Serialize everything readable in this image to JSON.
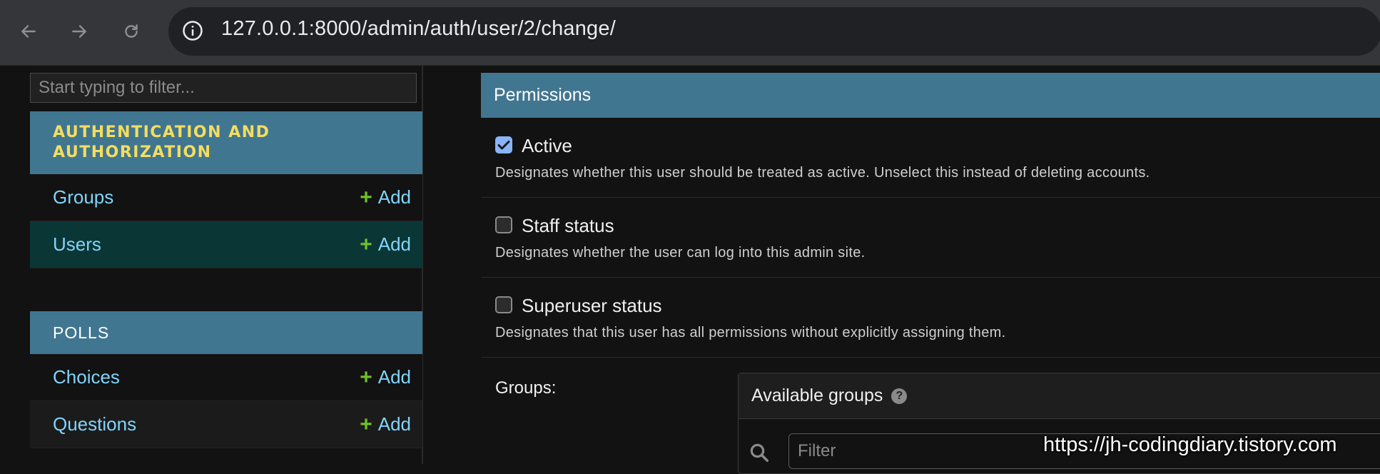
{
  "browser": {
    "url": "127.0.0.1:8000/admin/auth/user/2/change/",
    "icons": [
      "back-arrow-icon",
      "forward-arrow-icon",
      "reload-icon",
      "info-icon"
    ]
  },
  "sidebar": {
    "filter_placeholder": "Start typing to filter...",
    "apps": [
      {
        "name": "AUTHENTICATION AND AUTHORIZATION",
        "models": [
          {
            "name": "Groups",
            "add": "Add"
          },
          {
            "name": "Users",
            "add": "Add",
            "active": true
          }
        ]
      },
      {
        "name": "POLLS",
        "models": [
          {
            "name": "Choices",
            "add": "Add"
          },
          {
            "name": "Questions",
            "add": "Add"
          }
        ]
      }
    ]
  },
  "main": {
    "fieldset_title": "Permissions",
    "fields": [
      {
        "label": "Active",
        "checked": true,
        "help": "Designates whether this user should be treated as active. Unselect this instead of deleting accounts."
      },
      {
        "label": "Staff status",
        "checked": false,
        "help": "Designates whether the user can log into this admin site."
      },
      {
        "label": "Superuser status",
        "checked": false,
        "help": "Designates that this user has all permissions without explicitly assigning them."
      }
    ],
    "groups": {
      "label": "Groups:",
      "selector_title": "Available groups",
      "filter_placeholder": "Filter"
    }
  },
  "watermark": "https://jh-codingdiary.tistory.com",
  "colors": {
    "module_header": "#417690",
    "link": "#81d4fa",
    "add_plus": "#70bf2b",
    "active_row": "#0a3635",
    "checkbox_checked": "#8ab4f8"
  }
}
